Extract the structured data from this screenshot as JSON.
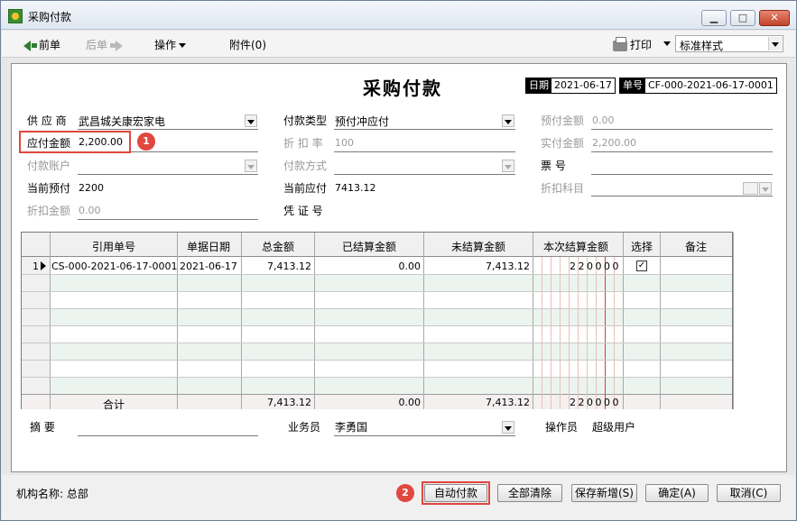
{
  "window": {
    "title": "采购付款"
  },
  "toolbar": {
    "prev": "前单",
    "next": "后单",
    "ops": "操作",
    "attach": "附件(0)",
    "print": "打印",
    "style": "标准样式"
  },
  "form": {
    "title": "采购付款",
    "date_label": "日期",
    "date": "2021-06-17",
    "no_label": "单号",
    "no": "CF-000-2021-06-17-0001",
    "supplier_label": "供 应 商",
    "supplier": "武昌城关康宏家电",
    "type_label": "付款类型",
    "type": "预付冲应付",
    "prepay_amount_label": "预付金额",
    "prepay_amount": "0.00",
    "payable_label": "应付金额",
    "payable": "2,200.00",
    "discount_rate_label": "折 扣 率",
    "discount_rate": "100",
    "actual_label": "实付金额",
    "actual": "2,200.00",
    "account_label": "付款账户",
    "method_label": "付款方式",
    "ticket_label": "票    号",
    "cur_prepay_label": "当前预付",
    "cur_prepay": "2200",
    "cur_payable_label": "当前应付",
    "cur_payable": "7413.12",
    "discount_subject_label": "折扣科目",
    "discount_amount_label": "折扣金额",
    "discount_amount": "0.00",
    "voucher_label": "凭 证 号",
    "remark_label": "摘    要",
    "salesman_label": "业务员",
    "salesman": "李勇国",
    "operator_label": "操作员",
    "operator": "超级用户"
  },
  "badges": [
    "1",
    "2"
  ],
  "grid": {
    "headers": [
      "引用单号",
      "单据日期",
      "总金额",
      "已结算金额",
      "未结算金额",
      "本次结算金额",
      "选择",
      "备注"
    ],
    "rows": [
      {
        "index": "1",
        "ref": "CS-000-2021-06-17-0001",
        "date": "2021-06-17",
        "total": "7,413.12",
        "settled": "0.00",
        "unsettled": "7,413.12",
        "this_digits": "220000",
        "checked": "✓"
      }
    ],
    "footer": {
      "label": "合计",
      "total": "7,413.12",
      "settled": "0.00",
      "unsettled": "7,413.12",
      "this_digits": "220000"
    }
  },
  "status": {
    "org": "机构名称: 总部",
    "auto_pay": "自动付款",
    "clear_all": "全部清除",
    "save_new": "保存新增(S)",
    "ok": "确定(A)",
    "cancel": "取消(C)"
  }
}
